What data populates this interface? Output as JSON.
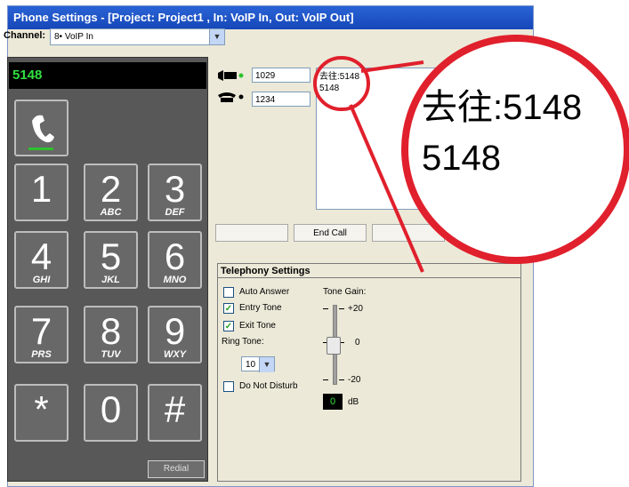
{
  "window": {
    "title": "Phone Settings - [Project: Project1 , In: VoIP In, Out: VoIP Out]"
  },
  "channel": {
    "label": "Channel:",
    "value": "8•  VoIP In"
  },
  "display": {
    "number": "5148"
  },
  "keypad": {
    "keys": [
      {
        "digit": "1",
        "letters": ""
      },
      {
        "digit": "2",
        "letters": "ABC"
      },
      {
        "digit": "3",
        "letters": "DEF"
      },
      {
        "digit": "4",
        "letters": "GHI"
      },
      {
        "digit": "5",
        "letters": "JKL"
      },
      {
        "digit": "6",
        "letters": "MNO"
      },
      {
        "digit": "7",
        "letters": "PRS"
      },
      {
        "digit": "8",
        "letters": "TUV"
      },
      {
        "digit": "9",
        "letters": "WXY"
      },
      {
        "digit": "*",
        "letters": ""
      },
      {
        "digit": "0",
        "letters": ""
      },
      {
        "digit": "#",
        "letters": ""
      }
    ],
    "redial_label": "Redial"
  },
  "lines": {
    "incoming_number": "1029",
    "outgoing_number": "1234"
  },
  "caller_info": {
    "line1": "去往:5148",
    "line2": "5148"
  },
  "call_buttons": {
    "end_call_label": "End Call"
  },
  "telephony": {
    "title": "Telephony Settings",
    "auto_answer": {
      "label": "Auto Answer",
      "checked": false
    },
    "entry_tone": {
      "label": "Entry Tone",
      "checked": true
    },
    "exit_tone": {
      "label": "Exit Tone",
      "checked": true
    },
    "ring_tone": {
      "label": "Ring Tone:",
      "value": "10"
    },
    "do_not_disturb": {
      "label": "Do Not Disturb",
      "checked": false
    },
    "tone_gain": {
      "label": "Tone Gain:",
      "max_label": "+20",
      "mid_label": "0",
      "min_label": "-20",
      "value": "0",
      "unit": "dB"
    }
  },
  "zoom": {
    "line1": "去往:5148",
    "line2": "5148"
  },
  "colors": {
    "titlebar": "#1547b8",
    "display_text": "#30e040",
    "highlight_circle": "#e0202c",
    "keypad_bg": "#585858"
  }
}
